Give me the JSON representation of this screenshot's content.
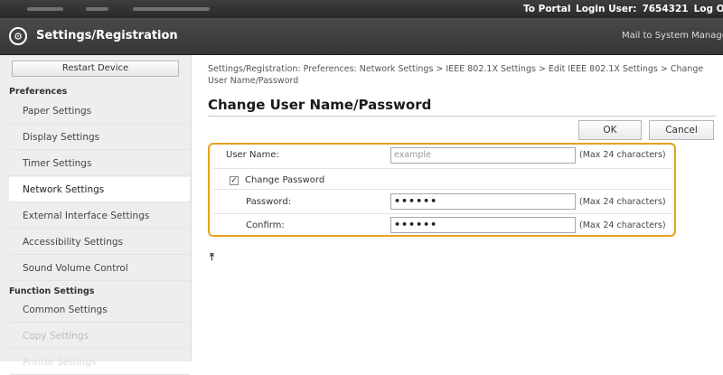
{
  "topbar": {
    "portal_label": "To Portal",
    "login_label": "Login User:",
    "login_user": "7654321",
    "logout_label": "Log Out"
  },
  "header": {
    "title": "Settings/Registration",
    "mail_link": "Mail to System Manager"
  },
  "sidebar": {
    "restart_label": "Restart Device",
    "group1": "Preferences",
    "items": [
      {
        "label": "Paper Settings"
      },
      {
        "label": "Display Settings"
      },
      {
        "label": "Timer Settings"
      },
      {
        "label": "Network Settings"
      },
      {
        "label": "External Interface Settings"
      },
      {
        "label": "Accessibility Settings"
      },
      {
        "label": "Sound Volume Control"
      }
    ],
    "group2": "Function Settings",
    "items2": [
      {
        "label": "Common Settings"
      },
      {
        "label": "Copy Settings"
      },
      {
        "label": "Printer Settings"
      }
    ]
  },
  "main": {
    "breadcrumb": "Settings/Registration: Preferences: Network Settings > IEEE 802.1X Settings > Edit IEEE 802.1X Settings > Change User Name/Password",
    "title": "Change User Name/Password",
    "ok_label": "OK",
    "cancel_label": "Cancel",
    "form": {
      "username_label": "User Name:",
      "username_value": "example",
      "username_hint": "(Max 24 characters)",
      "change_password_label": "Change Password",
      "change_password_checked": true,
      "password_label": "Password:",
      "password_value": "••••••",
      "password_hint": "(Max 24 characters)",
      "confirm_label": "Confirm:",
      "confirm_value": "••••••",
      "confirm_hint": "(Max 24 characters)"
    },
    "check_mark": "✓",
    "top_icon_glyph": "⤒"
  },
  "colors": {
    "highlight_border": "#e8a11b",
    "topbar": "#333333",
    "sidebar": "#eeeeee"
  }
}
